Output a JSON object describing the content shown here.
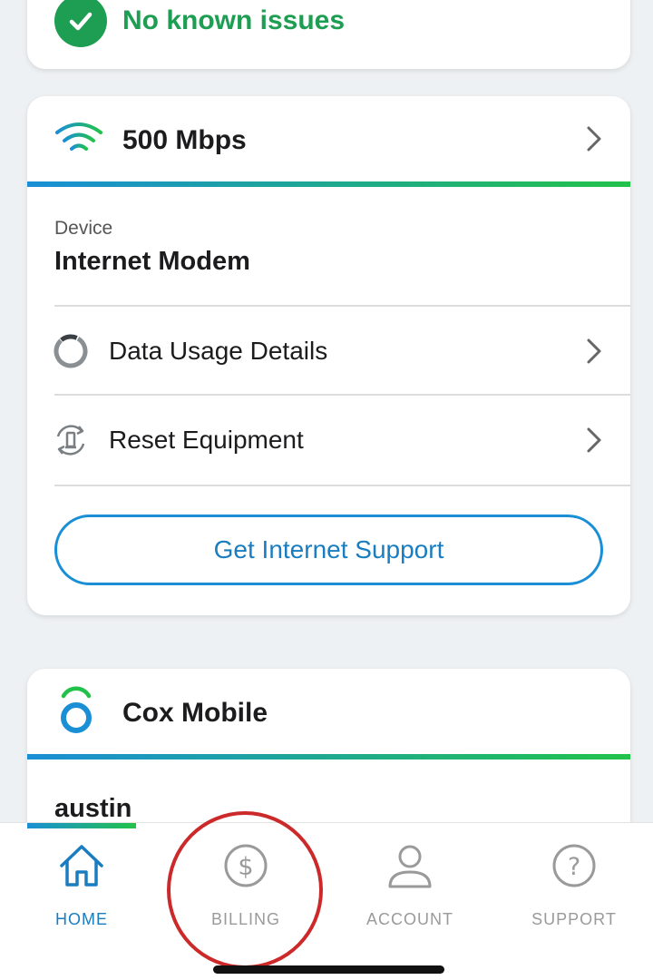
{
  "status": {
    "text": "No known issues",
    "icon": "check-circle-icon",
    "color": "#1e9e52"
  },
  "internet": {
    "speed": "500 Mbps",
    "device_label": "Device",
    "device_value": "Internet Modem",
    "rows": [
      {
        "label": "Data Usage Details",
        "icon": "data-usage-icon"
      },
      {
        "label": "Reset Equipment",
        "icon": "reset-equipment-icon"
      }
    ],
    "support_button": "Get Internet Support"
  },
  "mobile": {
    "title": "Cox Mobile",
    "user": "austin"
  },
  "tabbar": {
    "tabs": [
      {
        "label": "HOME",
        "icon": "home-icon",
        "active": true
      },
      {
        "label": "BILLING",
        "icon": "dollar-circle-icon",
        "active": false
      },
      {
        "label": "ACCOUNT",
        "icon": "person-icon",
        "active": false
      },
      {
        "label": "SUPPORT",
        "icon": "question-circle-icon",
        "active": false
      }
    ]
  },
  "colors": {
    "accent_blue": "#1a8fd6",
    "accent_green": "#22c24a",
    "annotation_red": "#cc2a2a"
  }
}
